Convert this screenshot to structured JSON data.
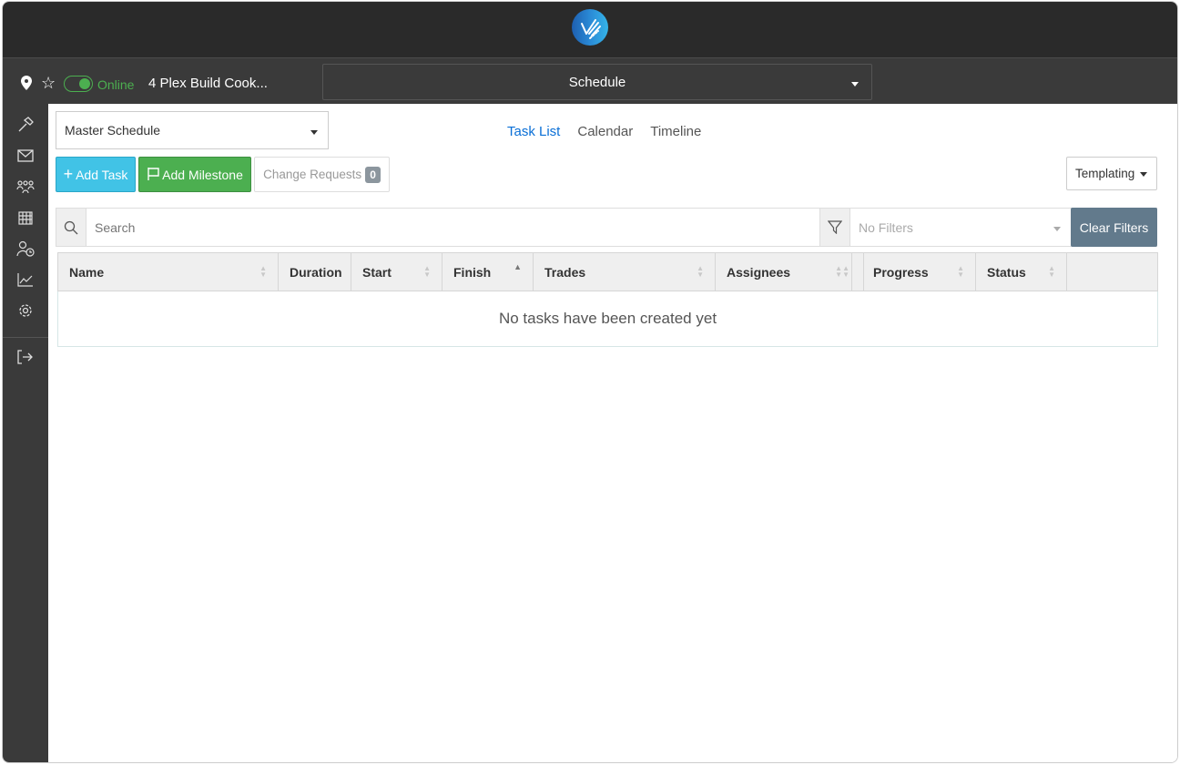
{
  "header": {
    "status": "Online",
    "project": "4 Plex Build Cook...",
    "section": "Schedule"
  },
  "sidebar": {
    "items": [
      "hammer-icon",
      "mail-icon",
      "users-icon",
      "calendar-icon",
      "user-clock-icon",
      "chart-icon",
      "gear-icon",
      "logout-icon"
    ]
  },
  "toolbar": {
    "schedule_select": "Master Schedule",
    "views": [
      "Task List",
      "Calendar",
      "Timeline"
    ],
    "add_task": "Add Task",
    "add_milestone": "Add Milestone",
    "change_requests": "Change Requests",
    "change_requests_count": "0",
    "templating": "Templating"
  },
  "search": {
    "placeholder": "Search",
    "filter_placeholder": "No Filters",
    "clear_filters": "Clear Filters"
  },
  "table": {
    "columns": [
      "Name",
      "Duration",
      "Start",
      "Finish",
      "Trades",
      "Assignees",
      "Progress",
      "Status"
    ],
    "empty": "No tasks have been created yet"
  },
  "colors": {
    "accent": "#0a6fd6",
    "online": "#4caf50",
    "add_task": "#41c3e6",
    "add_milestone": "#4caf50",
    "clear_filters": "#627a8c"
  }
}
